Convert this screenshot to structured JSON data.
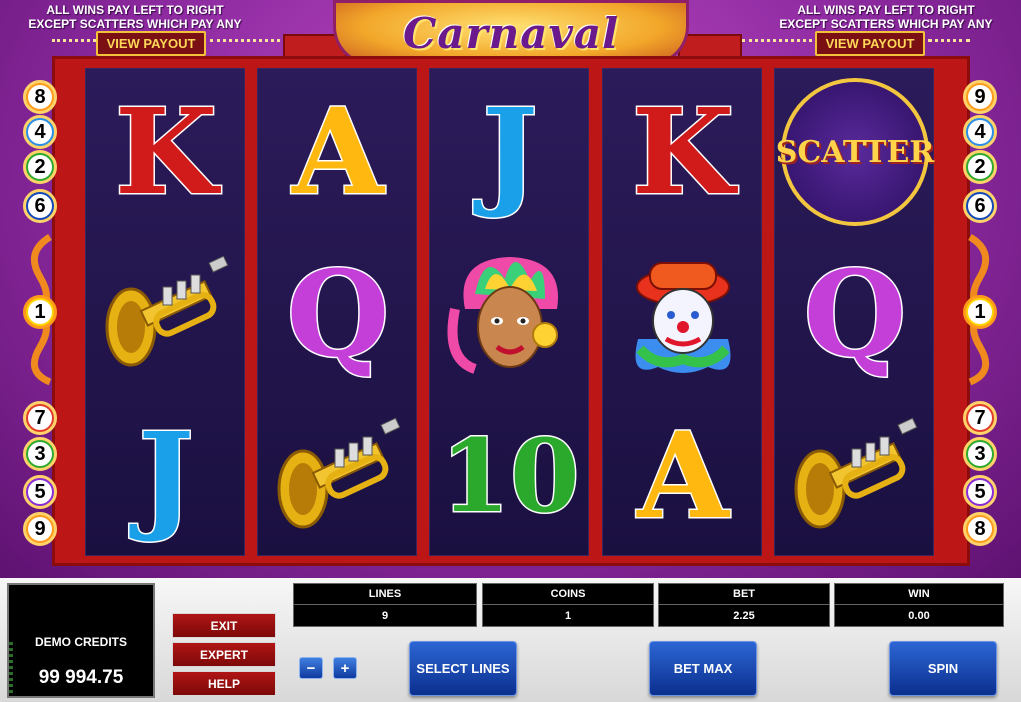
{
  "header": {
    "rules_left": [
      "ALL WINS PAY LEFT TO RIGHT",
      "EXCEPT SCATTERS WHICH PAY ANY"
    ],
    "rules_right": [
      "ALL WINS PAY LEFT TO RIGHT",
      "EXCEPT SCATTERS WHICH PAY ANY"
    ],
    "view_payout_left": "VIEW PAYOUT",
    "view_payout_right": "VIEW PAYOUT",
    "logo": "Carnaval"
  },
  "reels": [
    [
      "K",
      "trumpet",
      "J"
    ],
    [
      "A",
      "Q",
      "trumpet"
    ],
    [
      "J",
      "dancer",
      "10"
    ],
    [
      "K",
      "clown",
      "A"
    ],
    [
      "scatter",
      "Q",
      "trumpet"
    ]
  ],
  "scatter_label": "SCATTER",
  "payline_left": [
    "8",
    "4",
    "2",
    "6",
    "1",
    "7",
    "3",
    "5",
    "9"
  ],
  "payline_right": [
    "9",
    "4",
    "2",
    "6",
    "1",
    "7",
    "3",
    "5",
    "8"
  ],
  "credits": {
    "label": "DEMO CREDITS",
    "value": "99 994.75"
  },
  "buttons": {
    "exit": "EXIT",
    "expert": "EXPERT",
    "help": "HELP",
    "minus": "−",
    "plus": "+",
    "select_lines": "SELECT LINES",
    "bet_max": "BET MAX",
    "spin": "SPIN"
  },
  "stats": {
    "lines": {
      "label": "LINES",
      "value": "9"
    },
    "coins": {
      "label": "COINS",
      "value": "1"
    },
    "bet": {
      "label": "BET",
      "value": "2.25"
    },
    "win": {
      "label": "WIN",
      "value": "0.00"
    }
  },
  "colors": {
    "frame": "#bd1616",
    "panel_blue": "#1a4cbf",
    "background": "#8d2aa0"
  }
}
